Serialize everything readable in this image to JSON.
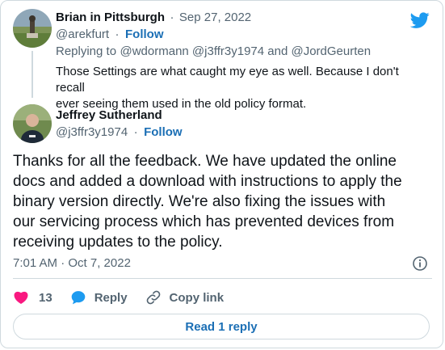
{
  "reply_tweet": {
    "author_name": "Brian in Pittsburgh",
    "separator": "·",
    "date": "Sep 27, 2022",
    "handle": "@arekfurt",
    "follow_separator": "·",
    "follow_label": "Follow",
    "replying_prefix": "Replying to",
    "replying_mentions": "@wdormann @j3ffr3y1974 and @JordGeurten",
    "text_line1": "Those Settings are what caught my eye as well. Because I don't recall",
    "text_line2": "ever seeing them used in the old policy format."
  },
  "main_tweet": {
    "author_name": "Jeffrey Sutherland",
    "handle": "@j3ffr3y1974",
    "follow_separator": "·",
    "follow_label": "Follow",
    "text_line1": "Thanks for all the feedback. We have updated the online",
    "text_line2": "docs and added a download with instructions to apply the",
    "text_line3": "binary version directly. We're also fixing the issues with",
    "text_line4": "our servicing process which has prevented devices from",
    "text_line5": "receiving updates to the policy.",
    "timestamp": "7:01 AM · Oct 7, 2022",
    "like_count": "13",
    "reply_label": "Reply",
    "copy_link_label": "Copy link",
    "read_reply_label": "Read 1 reply"
  },
  "colors": {
    "accent": "#1d9bf0",
    "like": "#f91880",
    "follow": "#1b6fb5",
    "muted": "#536471",
    "border": "#cfd9de"
  },
  "icons": [
    "twitter-bird-icon",
    "info-icon",
    "heart-icon",
    "reply-bubble-icon",
    "link-icon"
  ]
}
